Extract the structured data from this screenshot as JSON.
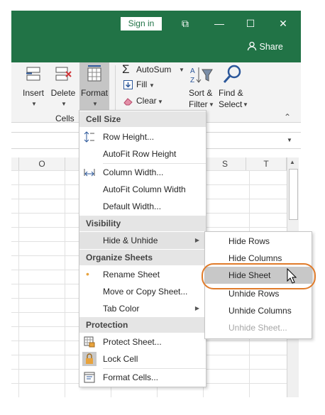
{
  "window": {
    "sign_in_label": "Sign in",
    "share_label": "Share",
    "restore_glyph": "⧉",
    "minimize_glyph": "—",
    "maximize_glyph": "☐",
    "close_glyph": "✕"
  },
  "ribbon": {
    "insert_label": "Insert",
    "delete_label": "Delete",
    "format_label": "Format",
    "cells_group_label": "Cells",
    "autosum_label": "AutoSum",
    "fill_label": "Fill",
    "clear_label": "Clear",
    "sort_filter_label_1": "Sort &",
    "sort_filter_label_2": "Filter",
    "find_select_label_1": "Find &",
    "find_select_label_2": "Select",
    "collapse_glyph": "⌃"
  },
  "sheet": {
    "columns": [
      "O",
      "S",
      "T"
    ]
  },
  "format_menu": {
    "cell_size_header": "Cell Size",
    "row_height": "Row Height...",
    "autofit_row_height": "AutoFit Row Height",
    "column_width": "Column Width...",
    "autofit_column_width": "AutoFit Column Width",
    "default_width": "Default Width...",
    "visibility_header": "Visibility",
    "hide_unhide": "Hide & Unhide",
    "organize_sheets_header": "Organize Sheets",
    "rename_sheet": "Rename Sheet",
    "move_copy_sheet": "Move or Copy Sheet...",
    "tab_color": "Tab Color",
    "protection_header": "Protection",
    "protect_sheet": "Protect Sheet...",
    "lock_cell": "Lock Cell",
    "format_cells": "Format Cells..."
  },
  "hide_submenu": {
    "hide_rows": "Hide Rows",
    "hide_columns": "Hide Columns",
    "hide_sheet": "Hide Sheet",
    "unhide_rows": "Unhide Rows",
    "unhide_columns": "Unhide Columns",
    "unhide_sheet": "Unhide Sheet..."
  },
  "colors": {
    "title_bar": "#217346",
    "highlight_oval": "#e07b2a"
  }
}
